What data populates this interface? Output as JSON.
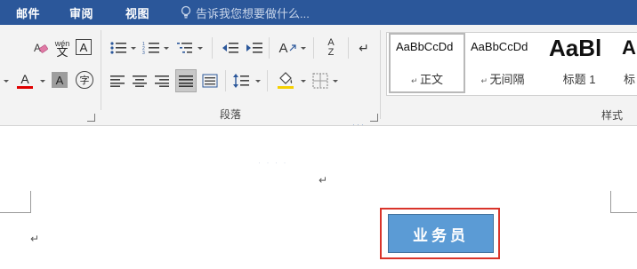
{
  "tabs": [
    "邮件",
    "审阅",
    "视图"
  ],
  "tell_me": {
    "placeholder": "告诉我您想要做什么..."
  },
  "ribbon": {
    "paragraph_group_label": "段落",
    "styles_group_label": "样式",
    "pinyin_label": "wén",
    "pinyin_char": "文",
    "char_border_label": "A",
    "font_color_label": "A",
    "shading_label": "A",
    "enclose_label": "字",
    "case_label": "A",
    "sort_label": "A",
    "sort_label2": "Z"
  },
  "styles": [
    {
      "preview": "AaBbCcDd",
      "name": "正文"
    },
    {
      "preview": "AaBbCcDd",
      "name": "无间隔"
    },
    {
      "preview": "AaBl",
      "name": "标题 1"
    },
    {
      "preview": "A",
      "name": "标"
    }
  ],
  "document": {
    "button_label": "业务员"
  },
  "colors": {
    "tab_bar": "#2b579a",
    "ribbon_bg": "#f3f3f3",
    "button_fill": "#5b9bd5",
    "highlight_border": "#d9342a",
    "font_color_underline": "#e00000"
  }
}
